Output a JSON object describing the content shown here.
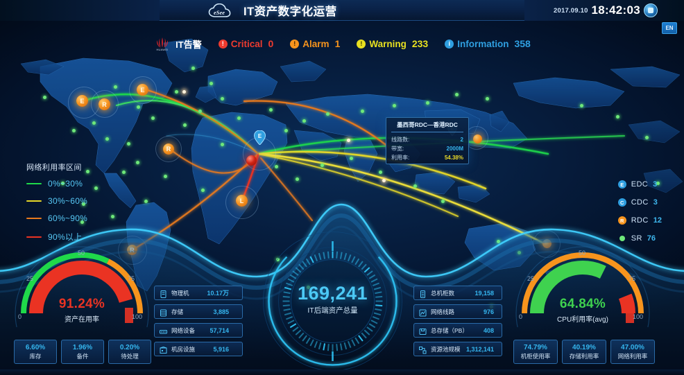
{
  "header": {
    "logo_text": "eSee",
    "title": "IT资产数字化运营",
    "date": "2017.09.10",
    "time": "18:42:03",
    "lang_button": "EN"
  },
  "alarm_bar": {
    "brand": "HUAWEI",
    "label": "IT告警",
    "items": [
      {
        "name": "Critical",
        "count": "0",
        "color": "#ee3b2f",
        "glyph": "!"
      },
      {
        "name": "Alarm",
        "count": "1",
        "color": "#f7941d",
        "glyph": "!"
      },
      {
        "name": "Warning",
        "count": "233",
        "color": "#e8e020",
        "glyph": "!"
      },
      {
        "name": "Information",
        "count": "358",
        "color": "#2f9fe0",
        "glyph": "i"
      }
    ]
  },
  "legend": {
    "title": "网络利用率区间",
    "rows": [
      {
        "label": "0%~30%",
        "color": "#1fd94a"
      },
      {
        "label": "30%~60%",
        "color": "#e8d928"
      },
      {
        "label": "60%~90%",
        "color": "#e87a1d"
      },
      {
        "label": "90%以上",
        "color": "#ea3323"
      }
    ]
  },
  "node_legend": [
    {
      "code": "E",
      "name": "EDC",
      "count": "3",
      "color": "#2f9fe0"
    },
    {
      "code": "C",
      "name": "CDC",
      "count": "3",
      "color": "#2f9fe0"
    },
    {
      "code": "R",
      "name": "RDC",
      "count": "12",
      "color": "#f7941d"
    },
    {
      "code": "",
      "name": "SR",
      "count": "76",
      "color": "#6ee87a"
    }
  ],
  "tooltip": {
    "title": "墨西哥RDC—香港RDC",
    "rows": [
      {
        "key": "线路数:",
        "value": "2",
        "color": "#35b6ef"
      },
      {
        "key": "带宽:",
        "value": "2000M",
        "color": "#35b6ef"
      },
      {
        "key": "利用率:",
        "value": "54.38%",
        "color": "#e8d928"
      }
    ]
  },
  "gauge_left": {
    "value": "91.24%",
    "label": "资产在用率",
    "value_color": "#ea3323",
    "ticks": [
      "0",
      "25",
      "50",
      "75",
      "100"
    ]
  },
  "gauge_right": {
    "value": "64.84%",
    "label": "CPU利用率(avg)",
    "value_color": "#3fd24f",
    "ticks": [
      "0",
      "25",
      "50",
      "75",
      "100"
    ]
  },
  "center": {
    "number": "169,241",
    "label": "IT后端资产总量"
  },
  "pills_left": [
    {
      "icon": "server-icon",
      "name": "物理机",
      "value": "10.17万"
    },
    {
      "icon": "storage-icon",
      "name": "存储",
      "value": "3,885"
    },
    {
      "icon": "network-icon",
      "name": "网络设备",
      "value": "57,714"
    },
    {
      "icon": "datacenter-icon",
      "name": "机房设施",
      "value": "5,916"
    }
  ],
  "pills_right": [
    {
      "icon": "rack-icon",
      "name": "总机柜数",
      "value": "19,158"
    },
    {
      "icon": "line-icon",
      "name": "网络线路",
      "value": "976"
    },
    {
      "icon": "disk-icon",
      "name": "总存储（PB）",
      "value": "408"
    },
    {
      "icon": "pool-icon",
      "name": "资源池规模",
      "value": "1,312,141"
    }
  ],
  "stats_left": [
    {
      "value": "6.60%",
      "name": "库存"
    },
    {
      "value": "1.96%",
      "name": "备件"
    },
    {
      "value": "0.20%",
      "name": "待处理"
    }
  ],
  "stats_right": [
    {
      "value": "74.79%",
      "name": "机柜使用率"
    },
    {
      "value": "40.19%",
      "name": "存储利用率"
    },
    {
      "value": "47.00%",
      "name": "网络利用率"
    }
  ],
  "chart_data": {
    "type": "gauge",
    "title": "IT资产数字化运营",
    "gauges": [
      {
        "name": "资产在用率",
        "value": 91.24,
        "unit": "%",
        "min": 0,
        "max": 100
      },
      {
        "name": "CPU利用率(avg)",
        "value": 64.84,
        "unit": "%",
        "min": 0,
        "max": 100
      }
    ],
    "kpis": [
      {
        "name": "IT后端资产总量",
        "value": 169241
      },
      {
        "name": "物理机",
        "value": "10.17万"
      },
      {
        "name": "存储",
        "value": 3885
      },
      {
        "name": "网络设备",
        "value": 57714
      },
      {
        "name": "机房设施",
        "value": 5916
      },
      {
        "name": "总机柜数",
        "value": 19158
      },
      {
        "name": "网络线路",
        "value": 976
      },
      {
        "name": "总存储（PB）",
        "value": 408
      },
      {
        "name": "资源池规模",
        "value": 1312141
      },
      {
        "name": "库存",
        "value": 6.6,
        "unit": "%"
      },
      {
        "name": "备件",
        "value": 1.96,
        "unit": "%"
      },
      {
        "name": "待处理",
        "value": 0.2,
        "unit": "%"
      },
      {
        "name": "机柜使用率",
        "value": 74.79,
        "unit": "%"
      },
      {
        "name": "存储利用率",
        "value": 40.19,
        "unit": "%"
      },
      {
        "name": "网络利用率",
        "value": 47.0,
        "unit": "%"
      },
      {
        "name": "Critical",
        "value": 0
      },
      {
        "name": "Alarm",
        "value": 1
      },
      {
        "name": "Warning",
        "value": 233
      },
      {
        "name": "Information",
        "value": 358
      },
      {
        "name": "EDC",
        "value": 3
      },
      {
        "name": "CDC",
        "value": 3
      },
      {
        "name": "RDC",
        "value": 12
      },
      {
        "name": "SR",
        "value": 76
      }
    ],
    "legend_bands": [
      "0%~30%",
      "30%~60%",
      "60%~90%",
      "90%以上"
    ]
  }
}
